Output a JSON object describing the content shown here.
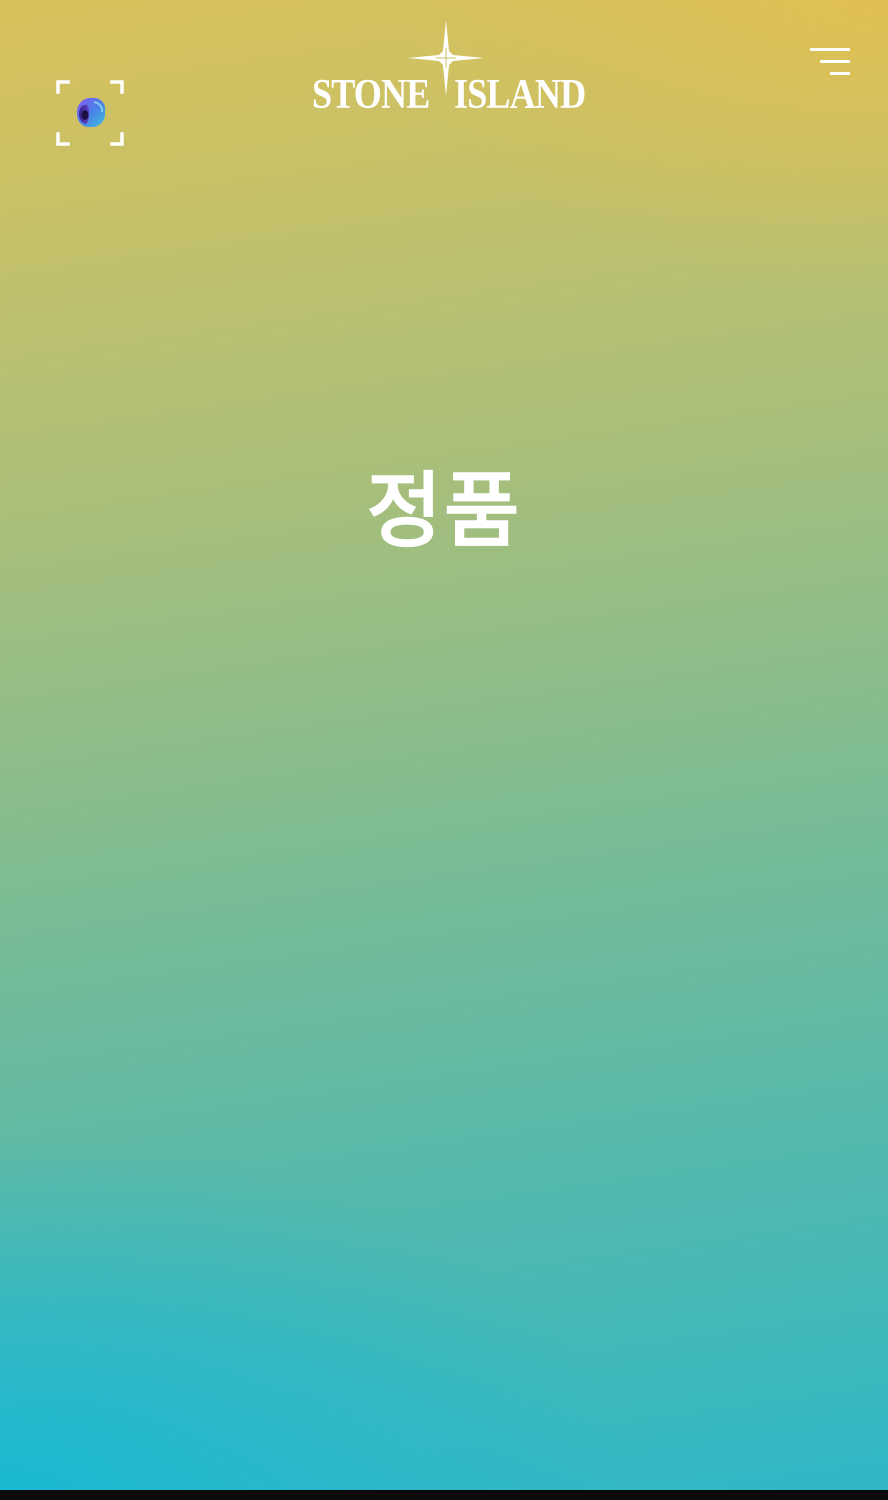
{
  "header": {
    "scan_icon": "ar-scan-icon",
    "logo": {
      "word_left": "STONE",
      "word_right": "ISLAND",
      "emblem_icon": "compass-rose-icon"
    },
    "menu_icon": "hamburger-menu-icon"
  },
  "main": {
    "headline": "정품"
  },
  "colors": {
    "gradient_top_right": "#e8be4c",
    "gradient_top": "#d4c05c",
    "gradient_middle": "#8fbd88",
    "gradient_bottom_left": "#1cb6d2",
    "text": "#ffffff"
  }
}
